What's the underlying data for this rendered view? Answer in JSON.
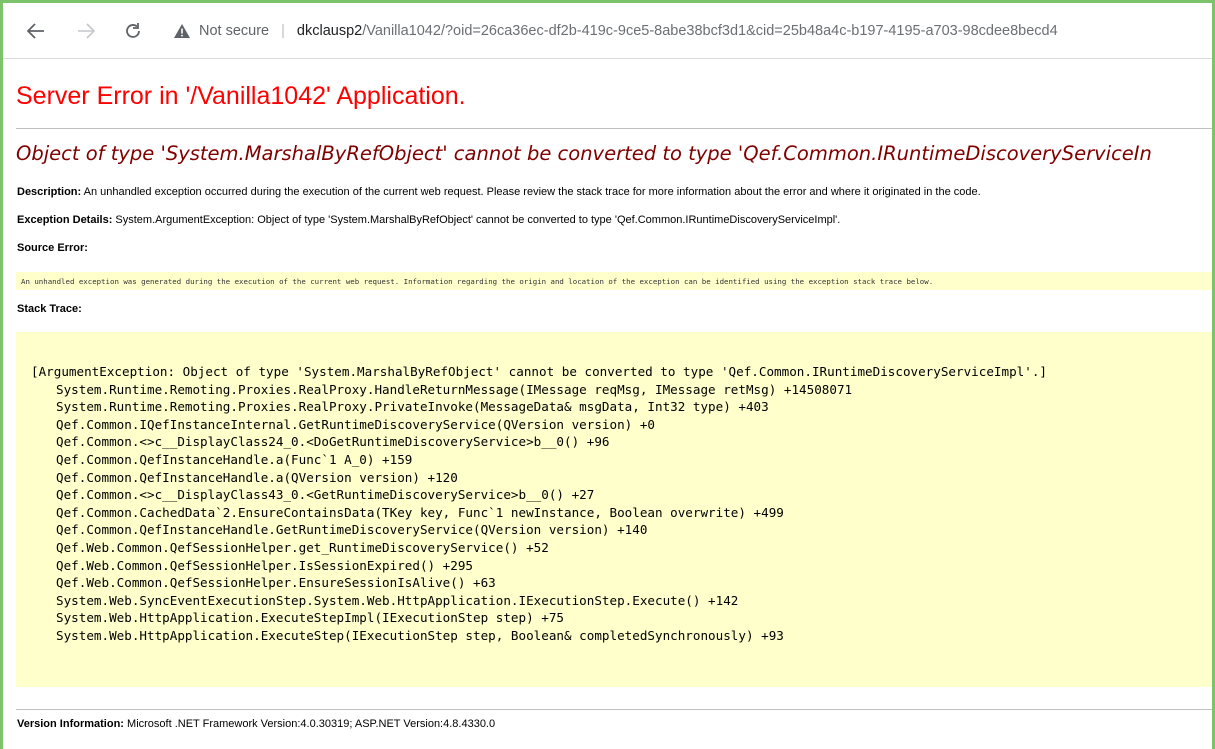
{
  "browser": {
    "security_label": "Not secure",
    "url_host": "dkclausp2",
    "url_path": "/Vanilla1042/?oid=26ca36ec-df2b-419c-9ce5-8abe38bcf3d1&cid=25b48a4c-b197-4195-a703-98cdee8becd4"
  },
  "error": {
    "title": "Server Error in '/Vanilla1042' Application.",
    "message": "Object of type 'System.MarshalByRefObject' cannot be converted to type 'Qef.Common.IRuntimeDiscoveryServiceIn",
    "description_label": "Description:",
    "description_text": " An unhandled exception occurred during the execution of the current web request. Please review the stack trace for more information about the error and where it originated in the code.",
    "exception_label": "Exception Details:",
    "exception_text": " System.ArgumentException: Object of type 'System.MarshalByRefObject' cannot be converted to type 'Qef.Common.IRuntimeDiscoveryServiceImpl'.",
    "source_error_label": "Source Error:",
    "source_error_text": "An unhandled exception was generated during the execution of the current web request. Information regarding the origin and location of the exception can be identified using the exception stack trace below.",
    "stack_trace_label": "Stack Trace:",
    "stack_header": "[ArgumentException: Object of type 'System.MarshalByRefObject' cannot be converted to type 'Qef.Common.IRuntimeDiscoveryServiceImpl'.]",
    "stack_lines": [
      "System.Runtime.Remoting.Proxies.RealProxy.HandleReturnMessage(IMessage reqMsg, IMessage retMsg) +14508071",
      "System.Runtime.Remoting.Proxies.RealProxy.PrivateInvoke(MessageData& msgData, Int32 type) +403",
      "Qef.Common.IQefInstanceInternal.GetRuntimeDiscoveryService(QVersion version) +0",
      "Qef.Common.<>c__DisplayClass24_0.<DoGetRuntimeDiscoveryService>b__0() +96",
      "Qef.Common.QefInstanceHandle.a(Func`1 A_0) +159",
      "Qef.Common.QefInstanceHandle.a(QVersion version) +120",
      "Qef.Common.<>c__DisplayClass43_0.<GetRuntimeDiscoveryService>b__0() +27",
      "Qef.Common.CachedData`2.EnsureContainsData(TKey key, Func`1 newInstance, Boolean overwrite) +499",
      "Qef.Common.QefInstanceHandle.GetRuntimeDiscoveryService(QVersion version) +140",
      "Qef.Web.Common.QefSessionHelper.get_RuntimeDiscoveryService() +52",
      "Qef.Web.Common.QefSessionHelper.IsSessionExpired() +295",
      "Qef.Web.Common.QefSessionHelper.EnsureSessionIsAlive() +63",
      "System.Web.SyncEventExecutionStep.System.Web.HttpApplication.IExecutionStep.Execute() +142",
      "System.Web.HttpApplication.ExecuteStepImpl(IExecutionStep step) +75",
      "System.Web.HttpApplication.ExecuteStep(IExecutionStep step, Boolean& completedSynchronously) +93"
    ],
    "version_label": "Version Information:",
    "version_text": " Microsoft .NET Framework Version:4.0.30319; ASP.NET Version:4.8.4330.0"
  },
  "colors": {
    "title": "#ff0000",
    "message": "#800000",
    "code_background": "#ffffcc",
    "frame_border": "#7cc36b"
  }
}
